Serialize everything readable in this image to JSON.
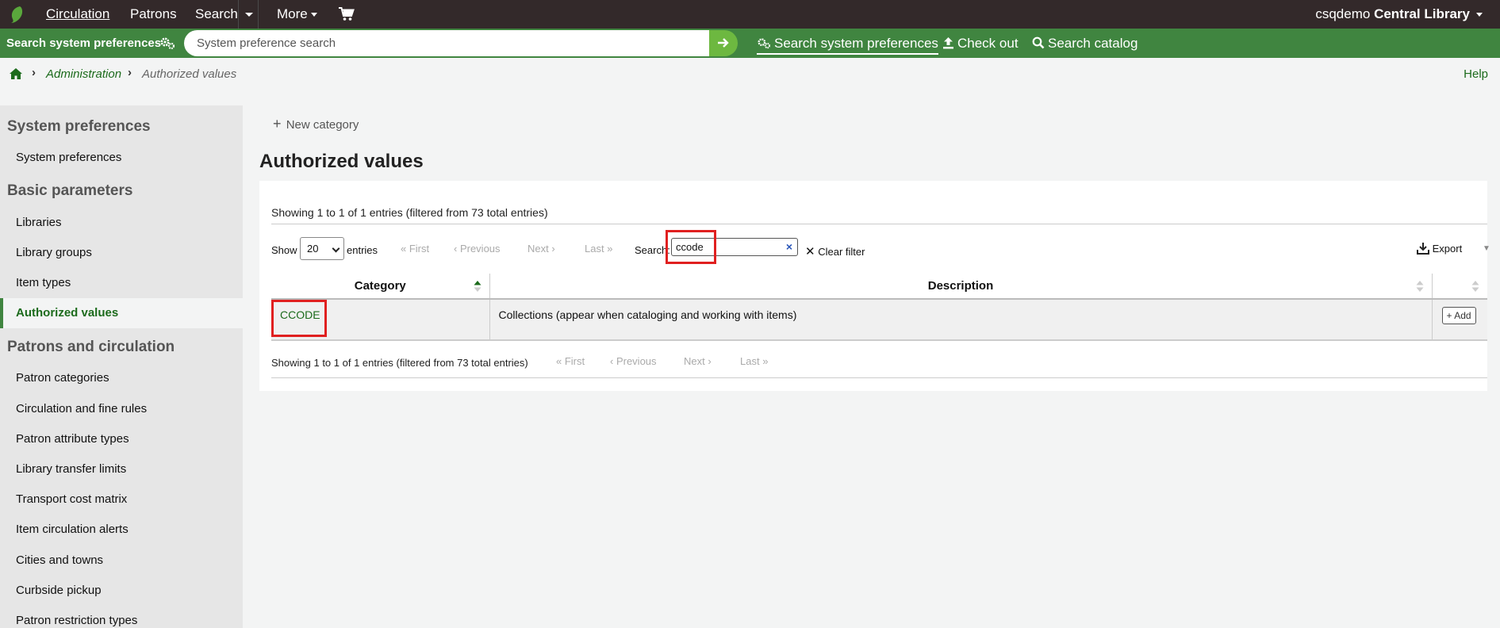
{
  "topnav": {
    "items": [
      "Circulation",
      "Patrons",
      "Search",
      "More"
    ],
    "user": "csqdemo",
    "library": "Central Library"
  },
  "header": {
    "search_label": "Search system preferences",
    "search_placeholder": "System preference search",
    "links": [
      "Search system preferences",
      "Check out",
      "Search catalog"
    ]
  },
  "breadcrumb": {
    "admin": "Administration",
    "current": "Authorized values",
    "help": "Help"
  },
  "sidebar": {
    "sections": [
      {
        "title": "System preferences",
        "items": [
          "System preferences"
        ]
      },
      {
        "title": "Basic parameters",
        "items": [
          "Libraries",
          "Library groups",
          "Item types",
          "Authorized values"
        ]
      },
      {
        "title": "Patrons and circulation",
        "items": [
          "Patron categories",
          "Circulation and fine rules",
          "Patron attribute types",
          "Library transfer limits",
          "Transport cost matrix",
          "Item circulation alerts",
          "Cities and towns",
          "Curbside pickup",
          "Patron restriction types"
        ]
      }
    ],
    "active": "Authorized values"
  },
  "main": {
    "new_category": "New category",
    "title": "Authorized values",
    "info": "Showing 1 to 1 of 1 entries (filtered from 73 total entries)",
    "show_label": "Show",
    "page_size": "20",
    "entries_label": "entries",
    "pagination": {
      "first": "First",
      "previous": "Previous",
      "next": "Next",
      "last": "Last"
    },
    "search_label": "Search:",
    "search_value": "ccode",
    "clear_filter": "Clear filter",
    "export": "Export",
    "columns": [
      "Category",
      "Description"
    ],
    "rows": [
      {
        "category": "CCODE",
        "description": "Collections (appear when cataloging and working with items)",
        "action": "Add"
      }
    ]
  },
  "colors": {
    "topnav_bg": "#33292a",
    "header_bg": "#408540",
    "link_green": "#1c6b1c",
    "highlight_red": "#e02020"
  }
}
